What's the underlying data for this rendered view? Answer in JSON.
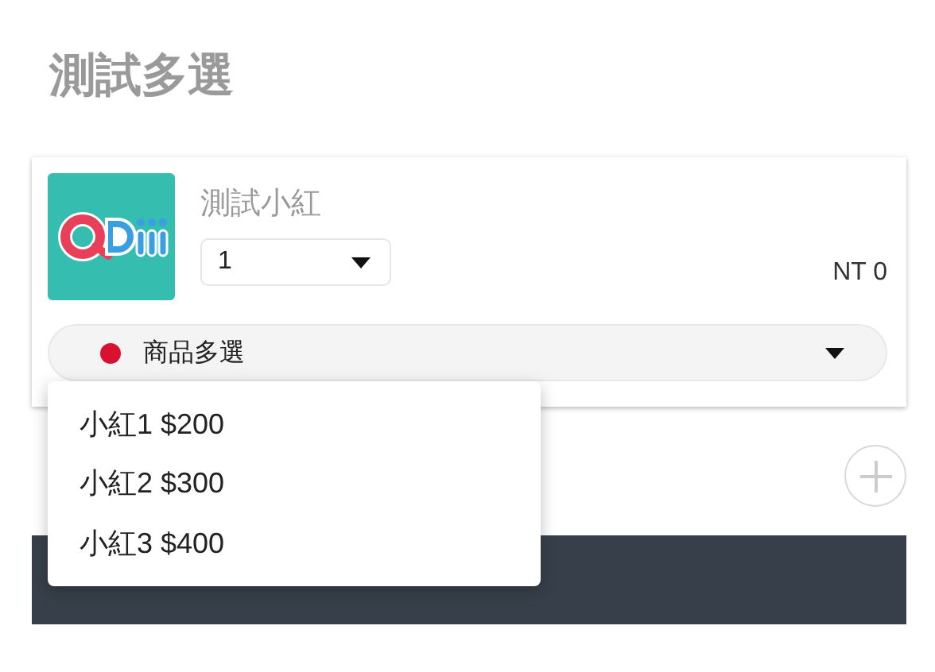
{
  "title": "測試多選",
  "product": {
    "name": "測試小紅",
    "quantity": "1",
    "price": "NT 0"
  },
  "option_select": {
    "label": "商品多選",
    "expanded": true,
    "options": [
      {
        "label": "小紅1 $200"
      },
      {
        "label": "小紅2 $300"
      },
      {
        "label": "小紅3 $400"
      }
    ]
  }
}
